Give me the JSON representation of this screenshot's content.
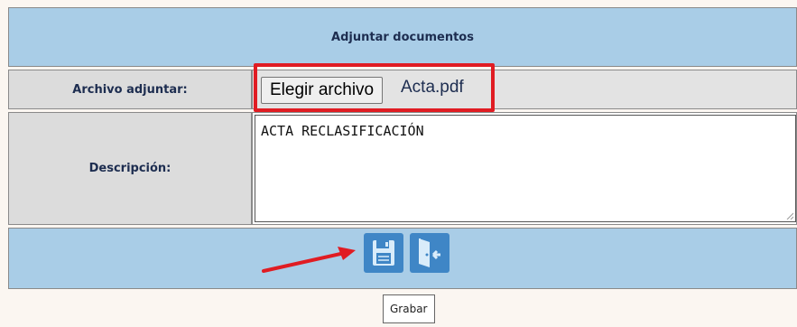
{
  "form": {
    "title": "Adjuntar documentos",
    "attachment": {
      "label": "Archivo adjuntar:",
      "choose_button": "Elegir archivo",
      "file_name": "Acta.pdf"
    },
    "description": {
      "label": "Descripción:",
      "value": "ACTA RECLASIFICACIÓN"
    },
    "actions": {
      "save_icon": "floppy-disk-icon",
      "exit_icon": "exit-door-icon",
      "tooltip": "Grabar"
    }
  },
  "annotations": {
    "highlight_color": "#e01c23",
    "arrow_color": "#e01c23"
  },
  "colors": {
    "header_bg": "#a9cde7",
    "label_bg": "#dcdcdc",
    "text_navy": "#1d2d50",
    "icon_blue": "#3f86c6"
  }
}
